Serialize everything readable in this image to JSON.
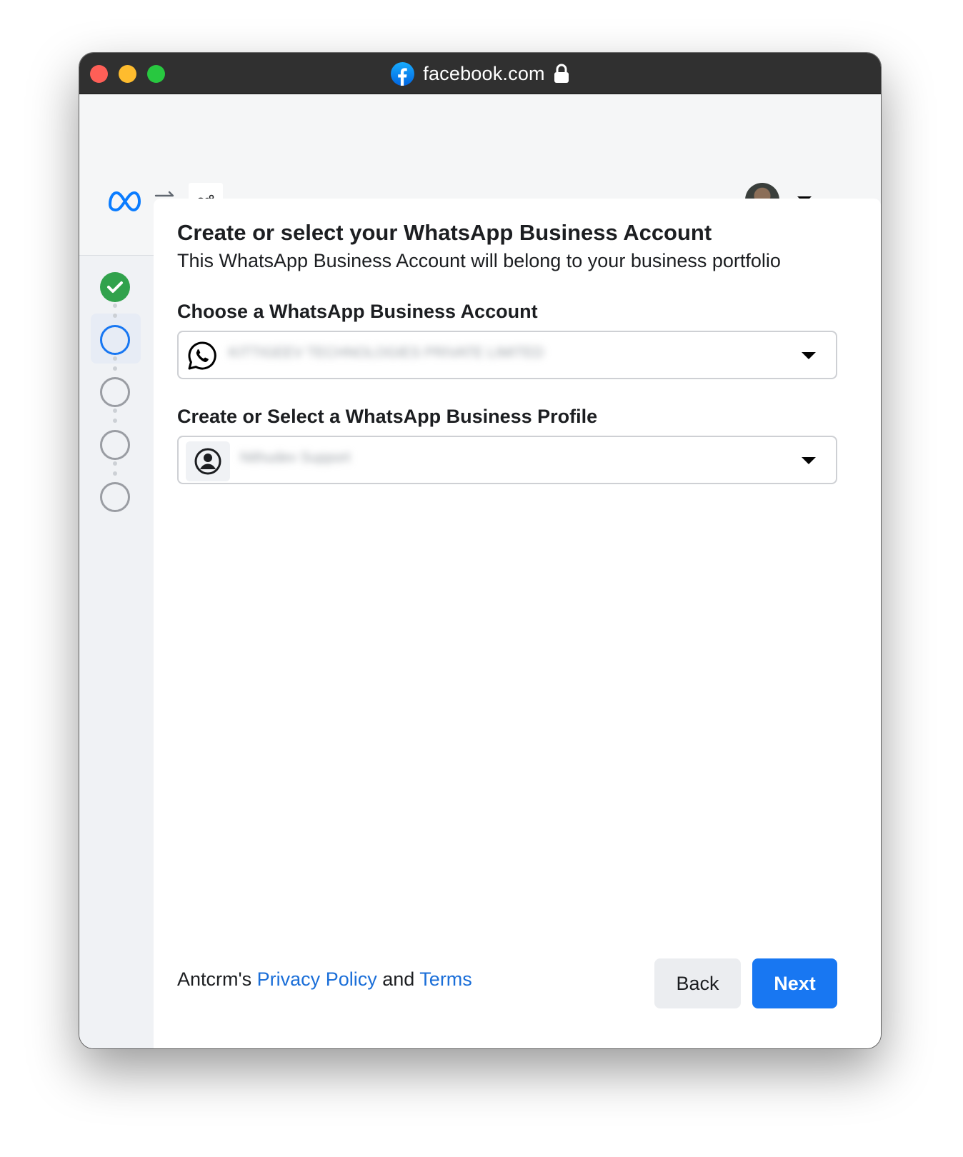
{
  "browser": {
    "url": "facebook.com",
    "site_icon": "facebook-icon",
    "lock_icon": "lock-icon"
  },
  "header": {
    "logo": "meta-logo",
    "swap_icon": "swap-icon",
    "app_icon": "app-icon",
    "account_avatar": "avatar"
  },
  "steps": [
    {
      "state": "done"
    },
    {
      "state": "current"
    },
    {
      "state": "todo"
    },
    {
      "state": "todo"
    },
    {
      "state": "todo"
    }
  ],
  "main": {
    "title": "Create or select your WhatsApp Business Account",
    "subtitle": "This WhatsApp Business Account will belong to your business portfolio",
    "account_label": "Choose a WhatsApp Business Account",
    "account_value": "KITTIGEEV TECHNOLOGIES PRIVATE LIMITED",
    "profile_label": "Create or Select a WhatsApp Business Profile",
    "profile_value": "Nithudev Support"
  },
  "footer": {
    "prefix": "Antcrm's ",
    "privacy_link": "Privacy Policy",
    "and_text": " and ",
    "terms_link": "Terms",
    "back_label": "Back",
    "next_label": "Next"
  },
  "colors": {
    "primary": "#1877f2",
    "link": "#1a6ed8",
    "success": "#31a24c",
    "titlebar": "#303030"
  }
}
